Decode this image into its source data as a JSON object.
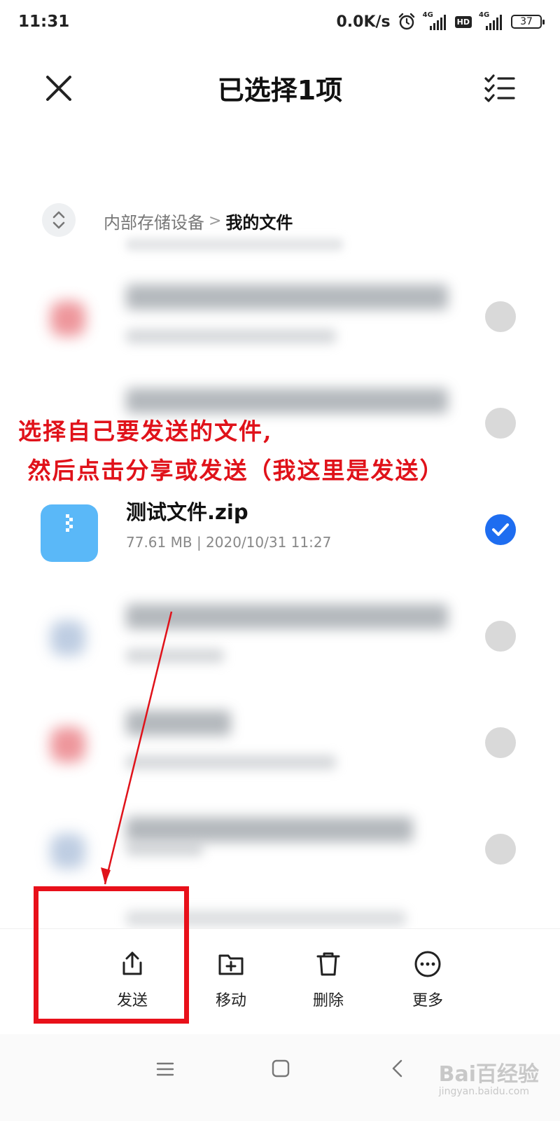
{
  "status_bar": {
    "time": "11:31",
    "net_speed": "0.0K/s",
    "sim1_label": "4G",
    "hd_label": "HD",
    "sim2_label": "4G",
    "battery": "37"
  },
  "header": {
    "title": "已选择1项",
    "close_icon": "close-icon",
    "select_all_icon": "checklist-icon"
  },
  "breadcrumb": {
    "parent": "内部存储设备",
    "separator": ">",
    "current": "我的文件"
  },
  "files": [
    {
      "icon_color": "#e8737a",
      "blurred": true,
      "selected": false
    },
    {
      "icon_color": "#ffffff",
      "blurred": true,
      "selected": false
    },
    {
      "name": "测试文件.zip",
      "meta": "77.61 MB  |  2020/10/31 11:27",
      "icon_color": "#5ab8f8",
      "selected": true
    },
    {
      "icon_color": "#a8bcd8",
      "blurred": true,
      "selected": false
    },
    {
      "icon_color": "#e8737a",
      "blurred": true,
      "selected": false
    },
    {
      "icon_color": "#a8bcd8",
      "blurred": true,
      "selected": false
    }
  ],
  "annotation": {
    "line1": "选择自己要发送的文件,",
    "line2": " 然后点击分享或发送（我这里是发送）",
    "color": "#e0121a"
  },
  "actions": [
    {
      "label": "发送",
      "icon": "share-icon"
    },
    {
      "label": "移动",
      "icon": "folder-plus-icon"
    },
    {
      "label": "删除",
      "icon": "trash-icon"
    },
    {
      "label": "更多",
      "icon": "more-icon"
    }
  ],
  "watermark": {
    "brand": "Bai百经验",
    "url": "jingyan.baidu.com"
  },
  "colors": {
    "accent": "#1e6df0",
    "highlight": "#e8101a"
  }
}
